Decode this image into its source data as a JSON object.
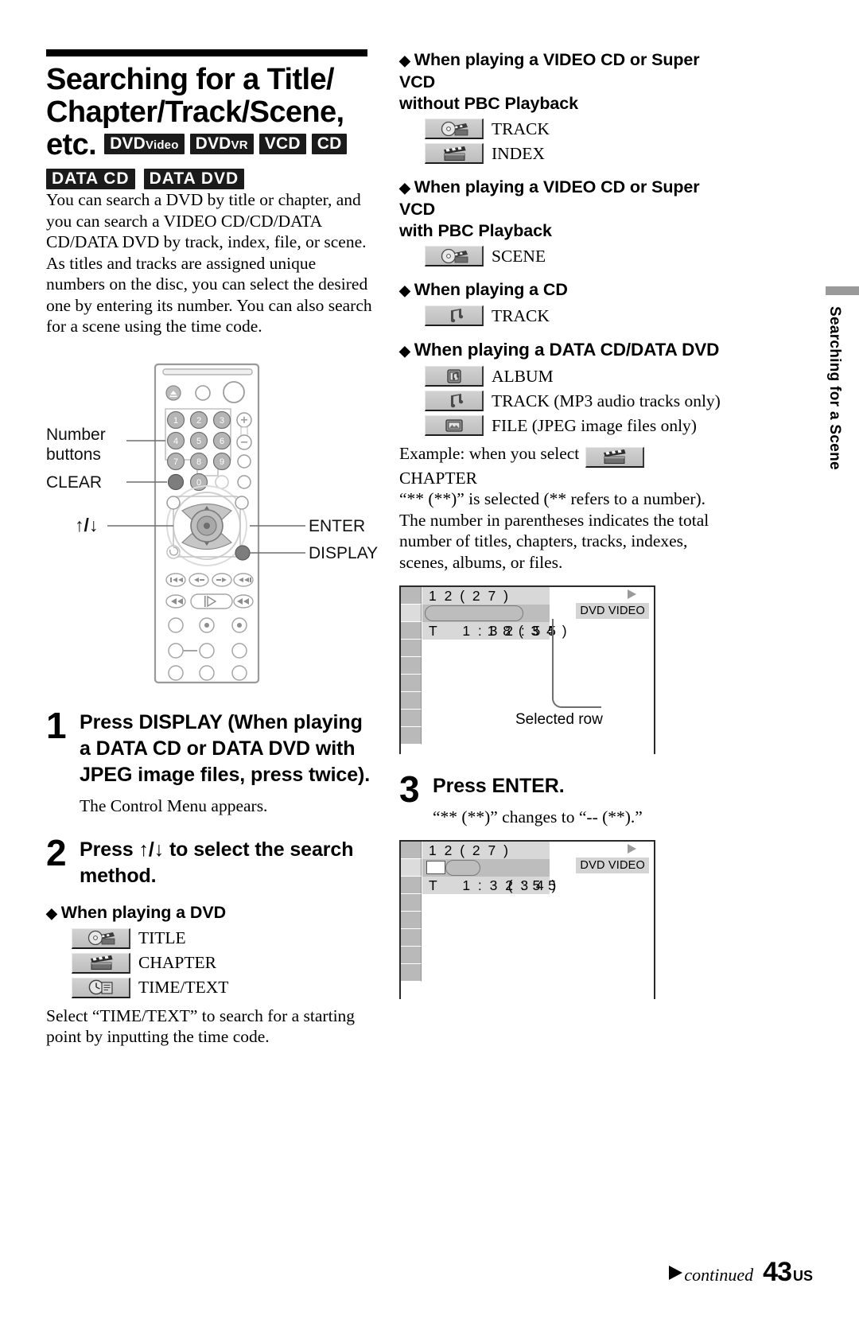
{
  "title": {
    "line1": "Searching for a Title/",
    "line2": "Chapter/Track/Scene,",
    "etc": "etc.",
    "chips_row1": [
      {
        "main": "DVD",
        "sub": "Video"
      },
      {
        "main": "DVD",
        "sub": "VR"
      },
      {
        "main": "VCD",
        "sub": ""
      },
      {
        "main": "CD",
        "sub": ""
      }
    ],
    "chips_row2": [
      "DATA CD",
      "DATA DVD"
    ]
  },
  "intro": "You can search a DVD by title or chapter, and you can search a VIDEO CD/CD/DATA CD/DATA DVD by track, index, file, or scene. As titles and tracks are assigned unique numbers on the disc, you can select the desired one by entering its number. You can also search for a scene using the time code.",
  "remote": {
    "label_number_buttons_line1": "Number",
    "label_number_buttons_line2": "buttons",
    "label_clear": "CLEAR",
    "label_updown": "↑/↓",
    "label_enter": "ENTER",
    "label_display": "DISPLAY",
    "keys": [
      "1",
      "2",
      "3",
      "4",
      "5",
      "6",
      "7",
      "8",
      "9",
      "0"
    ]
  },
  "steps": [
    {
      "num": "1",
      "text": "Press DISPLAY (When playing a DATA CD or DATA DVD with JPEG image files, press twice).",
      "sub": "The Control Menu appears."
    },
    {
      "num": "2",
      "text": "Press ↑/↓ to select the search method.",
      "sub": ""
    },
    {
      "num": "3",
      "text": "Press ENTER.",
      "sub": "“** (**)” changes to “-- (**).”"
    }
  ],
  "sections": [
    {
      "heading": "When playing a DVD",
      "items": [
        {
          "icon": "title-disc-icon",
          "label": "TITLE"
        },
        {
          "icon": "chapter-clapper-icon",
          "label": "CHAPTER"
        },
        {
          "icon": "time-text-clock-icon",
          "label": "TIME/TEXT"
        }
      ],
      "note": "Select “TIME/TEXT” to search for a starting point by inputting the time code."
    },
    {
      "heading_line1": "When playing a VIDEO CD or Super VCD",
      "heading_line2": "without PBC Playback",
      "items": [
        {
          "icon": "title-disc-icon",
          "label": "TRACK"
        },
        {
          "icon": "chapter-clapper-icon",
          "label": "INDEX"
        }
      ]
    },
    {
      "heading_line1": "When playing a VIDEO CD or Super VCD",
      "heading_line2": "with PBC Playback",
      "items": [
        {
          "icon": "title-disc-icon",
          "label": "SCENE"
        }
      ]
    },
    {
      "heading": "When playing a CD",
      "items": [
        {
          "icon": "music-note-icon",
          "label": "TRACK"
        }
      ]
    },
    {
      "heading": "When playing a DATA CD/DATA DVD",
      "items": [
        {
          "icon": "album-icon",
          "label": "ALBUM"
        },
        {
          "icon": "music-note-icon",
          "label": "TRACK (MP3 audio tracks only)"
        },
        {
          "icon": "file-image-icon",
          "label": "FILE (JPEG image files only)"
        }
      ]
    }
  ],
  "example": {
    "lead": "Example: when you select",
    "icon": "chapter-clapper-icon",
    "selected": "CHAPTER",
    "paragraph": "“** (**)” is selected (** refers to a number). The number in parentheses indicates the total number of titles, chapters, tracks, indexes, scenes, albums, or files."
  },
  "osd_before": {
    "row1": "1 2 ( 2 7 )",
    "row2": "1 8 ( 3 4 )",
    "row3": "T    1 : 3 2 : 5 5",
    "badge": "DVD VIDEO",
    "callout": "Selected row"
  },
  "osd_after": {
    "row1": "1 2 ( 2 7 )",
    "row2_prefix": "- -",
    "row2": "( 3 4 )",
    "row3": "T    1 : 3 2 : 5 5",
    "badge": "DVD VIDEO"
  },
  "side_tab": {
    "text": "Searching for a Scene"
  },
  "footer": {
    "continued": "continued",
    "page": "43",
    "region": "US"
  }
}
